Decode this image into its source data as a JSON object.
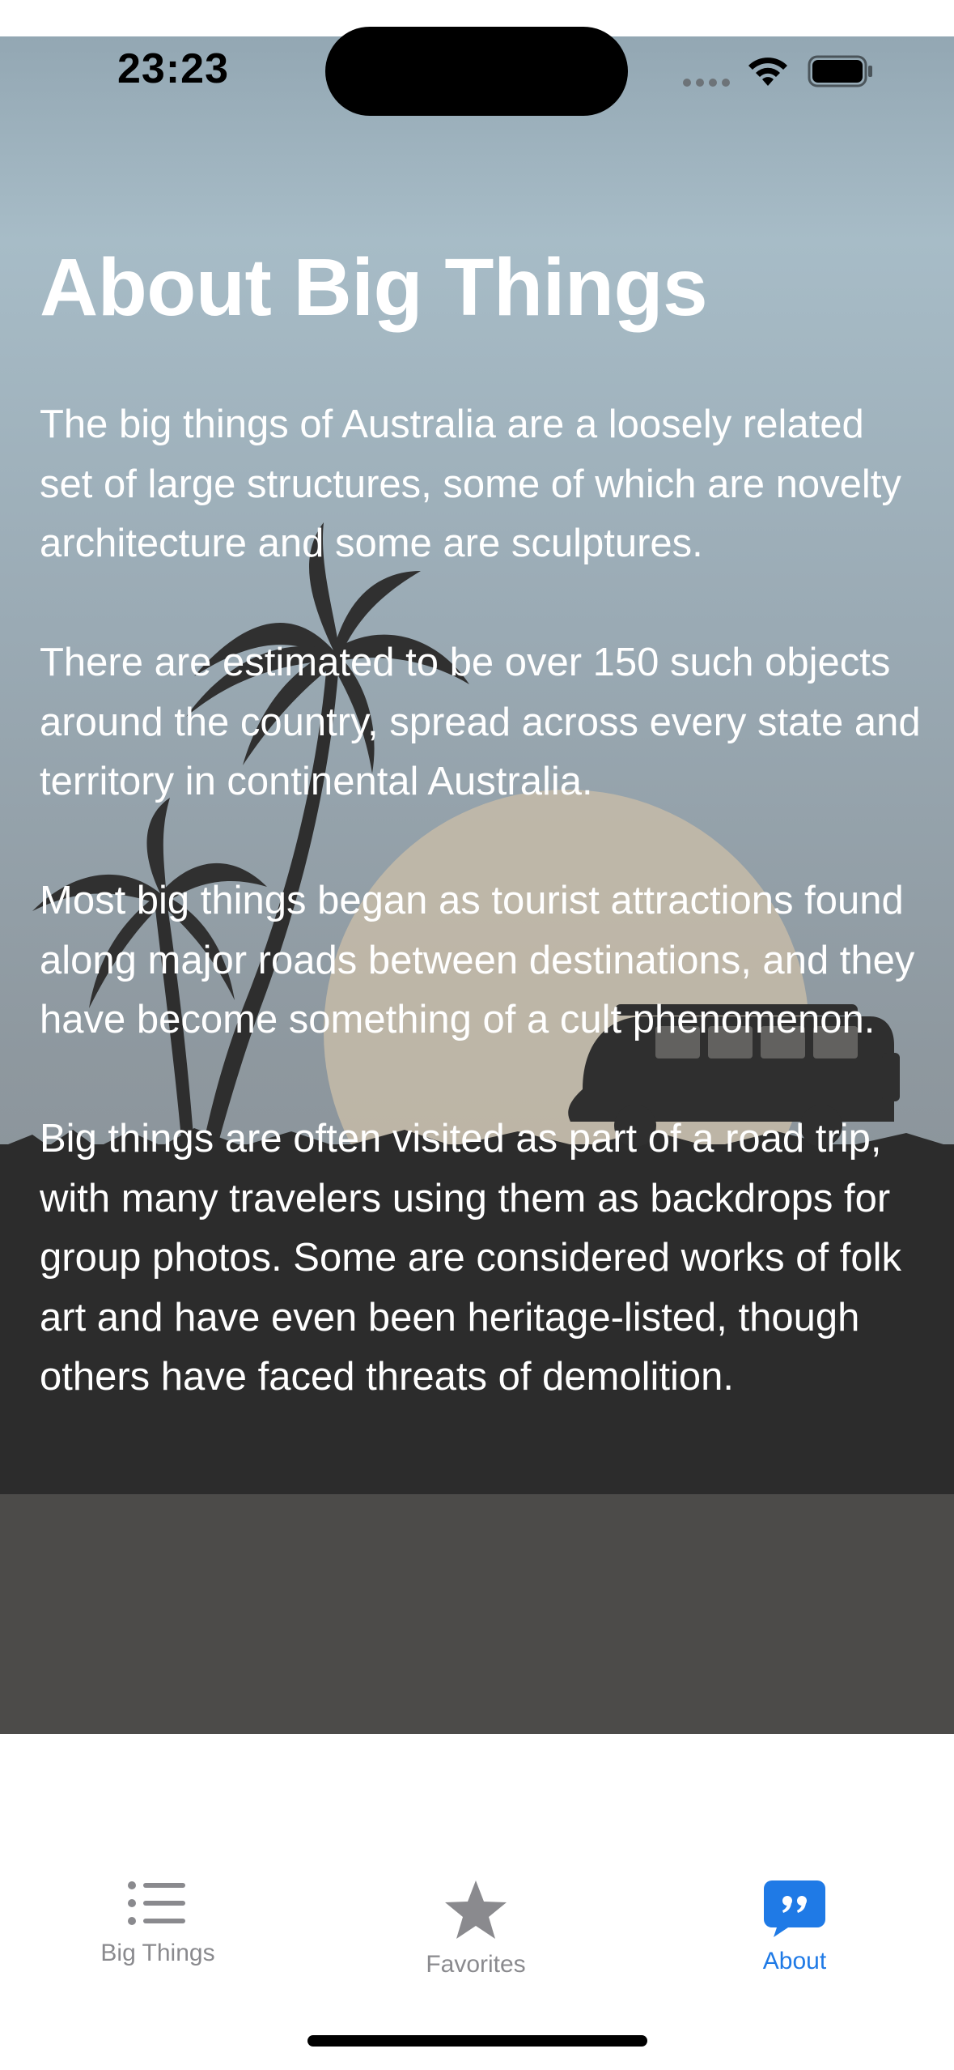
{
  "status": {
    "time": "23:23"
  },
  "about": {
    "title": "About Big Things",
    "paragraphs": [
      "The big things of Australia are a loosely related set of large structures, some of which are novelty architecture and some are sculptures.",
      "There are estimated to be over 150 such objects around the country, spread across every state and territory in continental Australia.",
      "Most big things began as tourist attractions found along major roads between destinations, and they have become something of a cult phenomenon.",
      "Big things are often visited as part of a road trip, with many travelers using them as backdrops for group photos. Some are considered works of folk art and have even been heritage-listed, though others have faced threats of demolition."
    ]
  },
  "tabs": [
    {
      "label": "Big Things",
      "icon": "list-icon",
      "selected": false
    },
    {
      "label": "Favorites",
      "icon": "star-icon",
      "selected": false
    },
    {
      "label": "About",
      "icon": "quote-bubble-icon",
      "selected": true
    }
  ],
  "colors": {
    "accent": "#1f7ae6",
    "inactive": "#8a8a8e"
  }
}
